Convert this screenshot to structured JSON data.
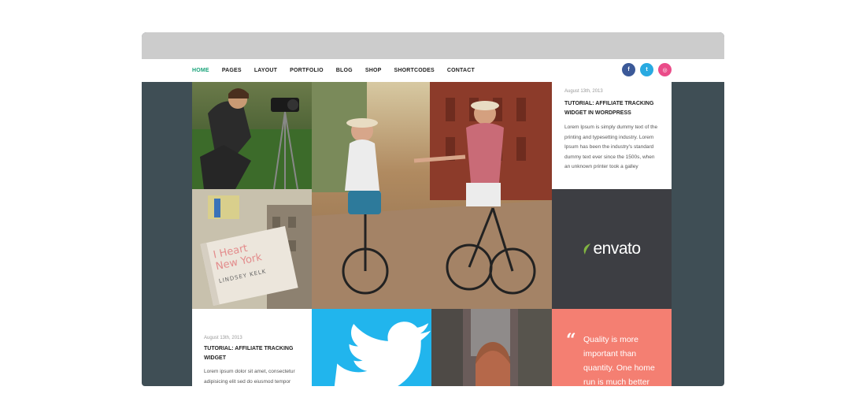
{
  "nav": {
    "items": [
      {
        "label": "HOME",
        "active": true
      },
      {
        "label": "PAGES",
        "active": false
      },
      {
        "label": "LAYOUT",
        "active": false
      },
      {
        "label": "PORTFOLIO",
        "active": false
      },
      {
        "label": "BLOG",
        "active": false
      },
      {
        "label": "SHOP",
        "active": false
      },
      {
        "label": "SHORTCODES",
        "active": false
      },
      {
        "label": "CONTACT",
        "active": false
      }
    ],
    "social": [
      {
        "icon": "facebook-icon",
        "glyph": "f",
        "color": "#3b5998"
      },
      {
        "icon": "twitter-icon",
        "glyph": "t",
        "color": "#29aae1"
      },
      {
        "icon": "dribbble-icon",
        "glyph": "◎",
        "color": "#ea4c89"
      }
    ]
  },
  "posts": {
    "top": {
      "date": "August 13th, 2013",
      "title": "TUTORIAL: AFFILIATE TRACKING WIDGET IN WORDPRESS",
      "excerpt": "Lorem Ipsum is simply dummy text of the printing and typesetting industry. Lorem Ipsum has been the industry's standard dummy text ever since the 1500s, when an unknown printer took a galley"
    },
    "bottom": {
      "date": "August 13th, 2013",
      "title": "TUTORIAL: AFFILIATE TRACKING WIDGET",
      "excerpt": "Lorem ipsum dolor sit amet, consectetur adipisicing elit sed do eiusmod tempor"
    }
  },
  "envato": {
    "logo_text": "envato"
  },
  "book": {
    "line1": "I Heart",
    "line2": "New York",
    "author": "LINDSEY KELK"
  },
  "quote": {
    "text": "Quality is more important than quantity. One home run is much better"
  },
  "colors": {
    "accent": "#1aa37a",
    "twitter": "#21b5ed",
    "quote": "#f47f72",
    "envato": "#3d3e43",
    "bg": "#3f4e55"
  }
}
